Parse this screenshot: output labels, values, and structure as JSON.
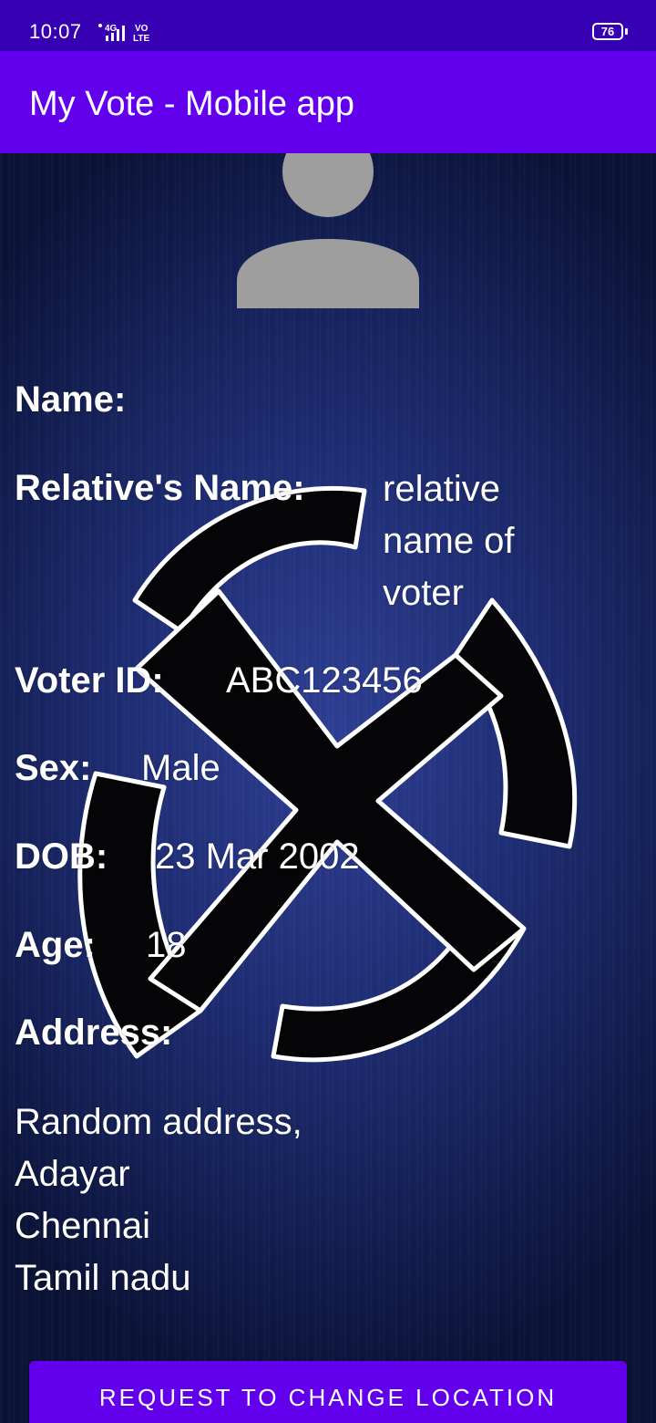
{
  "status_bar": {
    "time": "10:07",
    "network": "4G",
    "volte": "VO LTE",
    "battery": "76"
  },
  "app_bar": {
    "title": "My Vote - Mobile app",
    "color": "#6200ee"
  },
  "profile": {
    "avatar_icon": "person-avatar-icon",
    "background_icon": "election-commission-emblem",
    "fields": {
      "name": {
        "label": "Name:",
        "value": ""
      },
      "relative_name": {
        "label": "Relative's Name:",
        "value": "relative name of voter"
      },
      "voter_id": {
        "label": "Voter ID:",
        "value": "ABC123456"
      },
      "sex": {
        "label": "Sex:",
        "value": "Male"
      },
      "dob": {
        "label": "DOB:",
        "value": "23 Mar 2002"
      },
      "age": {
        "label": "Age:",
        "value": "18"
      },
      "address": {
        "label": "Address:",
        "lines": [
          "Random address,",
          "Adayar",
          "Chennai",
          "Tamil nadu"
        ]
      }
    }
  },
  "actions": {
    "change_location_label": "REQUEST TO CHANGE LOCATION"
  }
}
